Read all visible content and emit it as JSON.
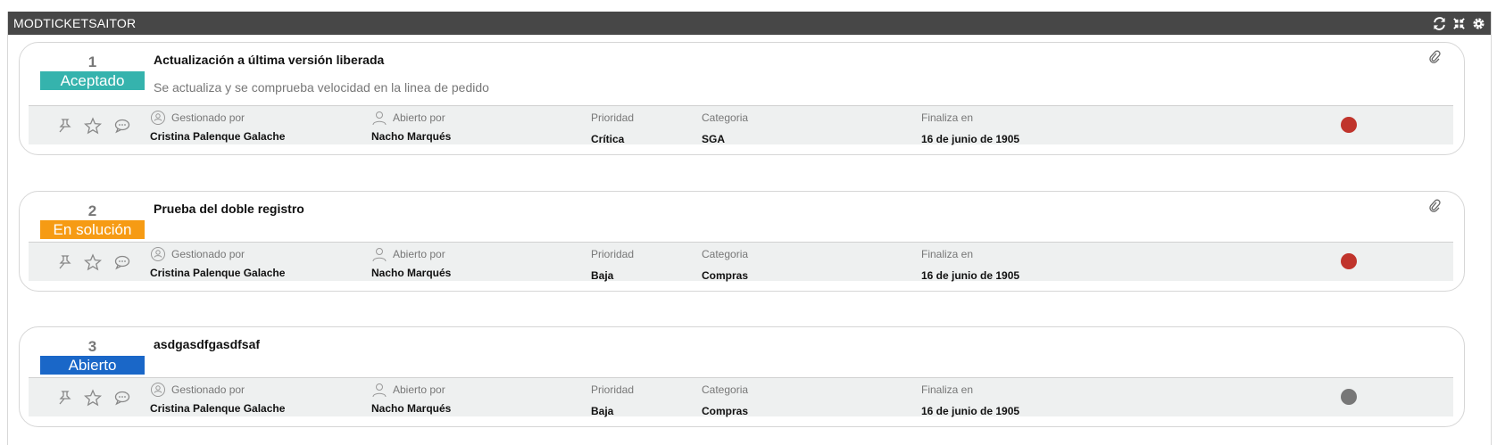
{
  "panel": {
    "title": "MODTICKETSAITOR",
    "actions": [
      "refresh-icon",
      "collapse-icon",
      "settings-icon"
    ]
  },
  "labels": {
    "managed_by": "Gestionado por",
    "opened_by": "Abierto por",
    "priority": "Prioridad",
    "category": "Categoria",
    "ends_in": "Finaliza en"
  },
  "colors": {
    "accepted": "#35b3ad",
    "in_solution": "#f69b14",
    "open": "#1a67c8",
    "dot_red": "#c0342c",
    "dot_gray": "#777777",
    "header_bg": "#474747"
  },
  "tickets": [
    {
      "id": "1",
      "status": "Aceptado",
      "title": "Actualización a última versión liberada",
      "description": "Se actualiza y se comprueba velocidad en la linea de pedido",
      "managed_by": "Cristina Palenque Galache",
      "opened_by": "Nacho Marqués",
      "priority": "Crítica",
      "category": "SGA",
      "ends_in": "16 de junio de 1905"
    },
    {
      "id": "2",
      "status": "En solución",
      "title": "Prueba del doble registro",
      "managed_by": "Cristina Palenque Galache",
      "opened_by": "Nacho Marqués",
      "priority": "Baja",
      "category": "Compras",
      "ends_in": "16 de junio de 1905"
    },
    {
      "id": "3",
      "status": "Abierto",
      "title": "asdgasdfgasdfsaf",
      "managed_by": "Cristina Palenque Galache",
      "opened_by": "Nacho Marqués",
      "priority": "Baja",
      "category": "Compras",
      "ends_in": "16 de junio de 1905"
    }
  ]
}
